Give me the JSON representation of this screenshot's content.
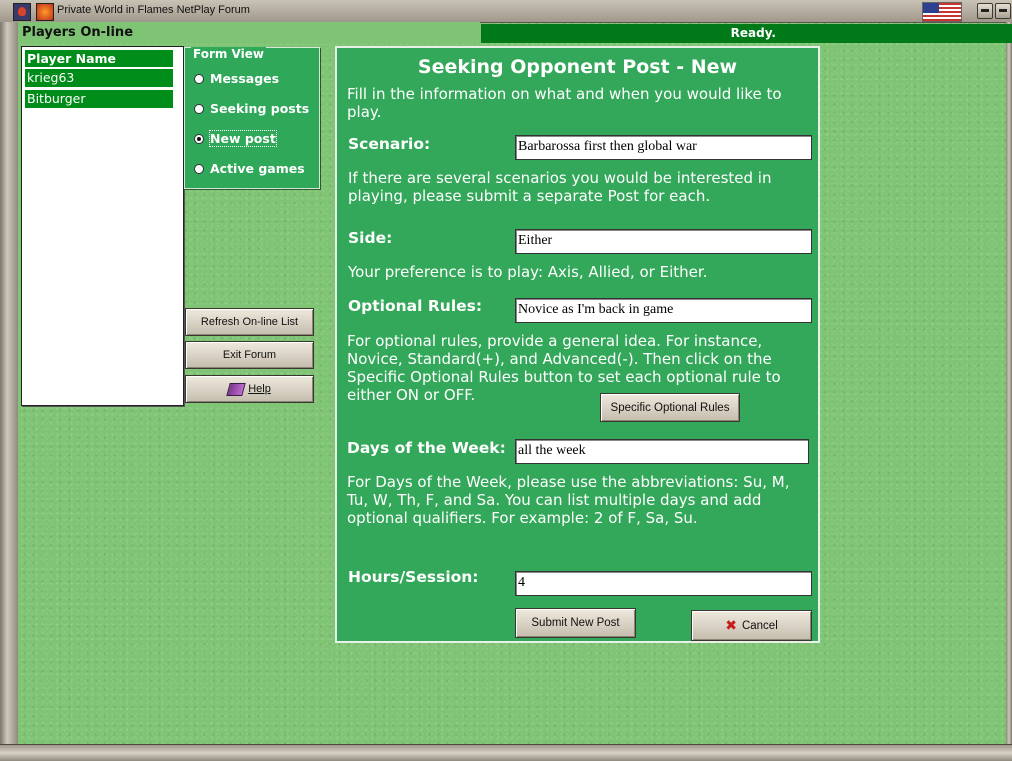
{
  "window": {
    "title": "Private World in Flames NetPlay Forum"
  },
  "players": {
    "title": "Players On-line",
    "list_header": "Player Name",
    "items": [
      {
        "name": "krieg63"
      },
      {
        "name": "Bitburger"
      }
    ]
  },
  "status": {
    "text": "Ready."
  },
  "form_view": {
    "legend": "Form View",
    "options": [
      {
        "label": "Messages",
        "selected": false
      },
      {
        "label": "Seeking posts",
        "selected": false
      },
      {
        "label": "New post",
        "selected": true
      },
      {
        "label": "Active games",
        "selected": false
      }
    ]
  },
  "sidebar_buttons": {
    "refresh": "Refresh On-line List",
    "exit": "Exit Forum",
    "help": "Help"
  },
  "form": {
    "title": "Seeking Opponent Post - New",
    "intro": "Fill in the information on what and when you would like to play.",
    "scenario": {
      "label": "Scenario:",
      "value": "Barbarossa first then global war",
      "help": "If there are several scenarios you would be interested in playing, please submit a separate Post for each."
    },
    "side": {
      "label": "Side:",
      "value": "Either",
      "help": "Your preference is to play: Axis, Allied, or Either."
    },
    "optional_rules": {
      "label": "Optional Rules:",
      "value": "Novice as I'm back in game",
      "help": "For optional rules, provide a general idea.  For instance, Novice, Standard(+), and Advanced(-).  Then click on the Specific Optional Rules button to set each optional rule to either ON or OFF.",
      "button": "Specific Optional Rules"
    },
    "days": {
      "label": "Days of the Week:",
      "value": "all the week",
      "help": "For Days of the Week, please use the abbreviations: Su, M, Tu, W, Th, F, and Sa.  You can list multiple days and add optional qualifiers.  For example: 2 of F, Sa, Su."
    },
    "hours": {
      "label": "Hours/Session:",
      "value": "4"
    },
    "submit_button": "Submit New Post",
    "cancel_button": "Cancel"
  }
}
